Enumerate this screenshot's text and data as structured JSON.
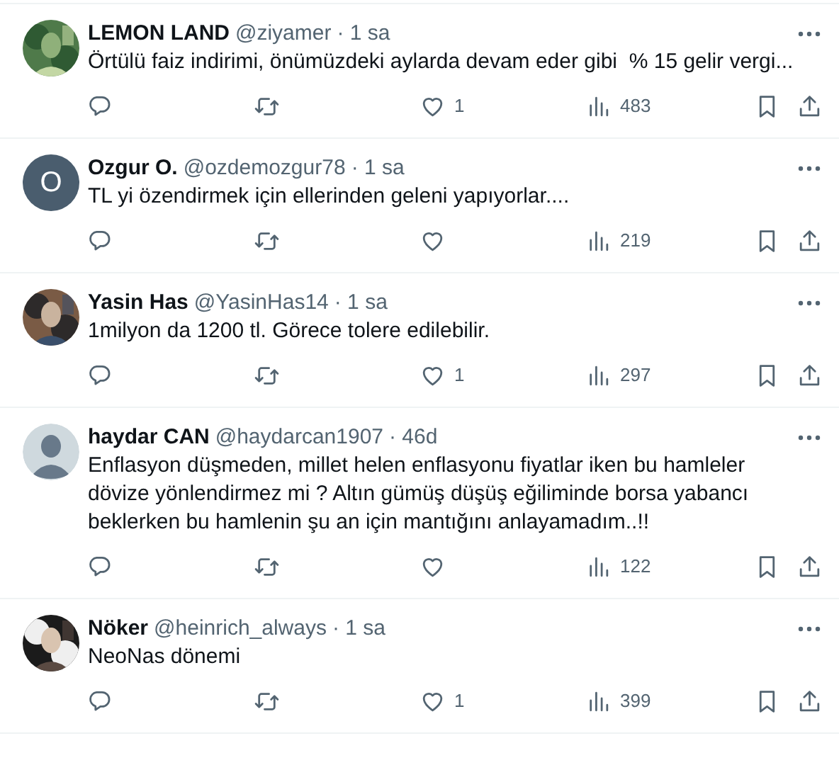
{
  "tweets": [
    {
      "name": "LEMON LAND",
      "handle": "@ziyamer",
      "time": "· 1 sa",
      "text": "Örtülü faiz indirimi, önümüzdeki aylarda devam eder gibi  % 15 gelir vergi...",
      "likes": "1",
      "views": "483"
    },
    {
      "avatar": {
        "kind": "letter",
        "letter": "O",
        "color": "#4a5d6e"
      },
      "name": "Ozgur O.",
      "handle": "@ozdemozgur78",
      "time": "· 1 sa",
      "text": "TL yi özendirmek için ellerinden geleni yapıyorlar....",
      "views": "219"
    },
    {
      "name": "Yasin Has",
      "handle": "@YasinHas14",
      "time": "· 1 sa",
      "text": "1milyon da 1200 tl. Görece tolere edilebilir.",
      "likes": "1",
      "views": "297"
    },
    {
      "avatar": {
        "kind": "default"
      },
      "name": "haydar CAN",
      "handle": "@haydarcan1907",
      "time": "· 46d",
      "text": "Enflasyon düşmeden, millet helen enflasyonu fiyatlar iken bu hamleler dövize yönlendirmez mi ? Altın gümüş düşüş eğiliminde borsa yabancı beklerken bu hamlenin şu an için mantığını anlayamadım..!!",
      "views": "122"
    },
    {
      "name": "Nöker",
      "handle": "@heinrich_always",
      "time": "· 1 sa",
      "text": "NeoNas dönemi",
      "likes": "1",
      "views": "399"
    }
  ]
}
